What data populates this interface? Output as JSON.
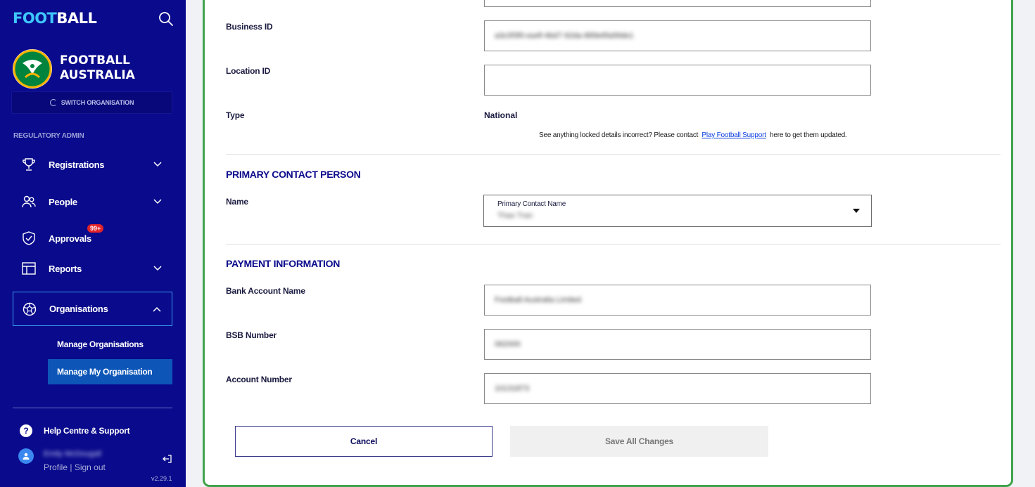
{
  "sidebar": {
    "brand_part1": "FOOT",
    "brand_part2": "BALL",
    "org_name": "FOOTBALL AUSTRALIA",
    "switch_org": "SWITCH ORGANISATION",
    "section_heading": "REGULATORY ADMIN",
    "items": [
      {
        "label": "Registrations",
        "icon": "trophy-icon"
      },
      {
        "label": "People",
        "icon": "people-icon"
      },
      {
        "label": "Approvals",
        "icon": "shield-check-icon",
        "badge": "99+"
      },
      {
        "label": "Reports",
        "icon": "reports-icon"
      },
      {
        "label": "Organisations",
        "icon": "football-icon"
      }
    ],
    "sub_items": [
      {
        "label": "Manage Organisations"
      },
      {
        "label": "Manage My Organisation"
      }
    ],
    "help": "Help Centre & Support",
    "user_name": "Emily McDougall",
    "profile": "Profile",
    "sign_out": "Sign out",
    "version": "v2.29.1"
  },
  "form": {
    "business_id_label": "Business ID",
    "business_id_value": "a3c0f3f0-ea4f-4bd7-92da-889e6fa99de1",
    "location_id_label": "Location ID",
    "location_id_value": "",
    "type_label": "Type",
    "type_value": "National",
    "notice_prefix": "See anything locked details incorrect? Please contact",
    "notice_link": "Play Football Support",
    "notice_suffix": "here to get them updated.",
    "primary_contact_title": "PRIMARY CONTACT PERSON",
    "name_label": "Name",
    "primary_contact_select_label": "Primary Contact Name",
    "primary_contact_value": "Thao Tran",
    "payment_title": "PAYMENT INFORMATION",
    "bank_account_name_label": "Bank Account Name",
    "bank_account_name_value": "Football Australia Limited",
    "bsb_label": "BSB Number",
    "bsb_value": "062000",
    "account_number_label": "Account Number",
    "account_number_value": "10131873",
    "cancel": "Cancel",
    "save": "Save All Changes"
  },
  "colors": {
    "sidebar_bg": "#0a0a8c",
    "accent_green": "#3fa34d",
    "active_sub": "#0d56b8",
    "badge": "#e0242b"
  }
}
